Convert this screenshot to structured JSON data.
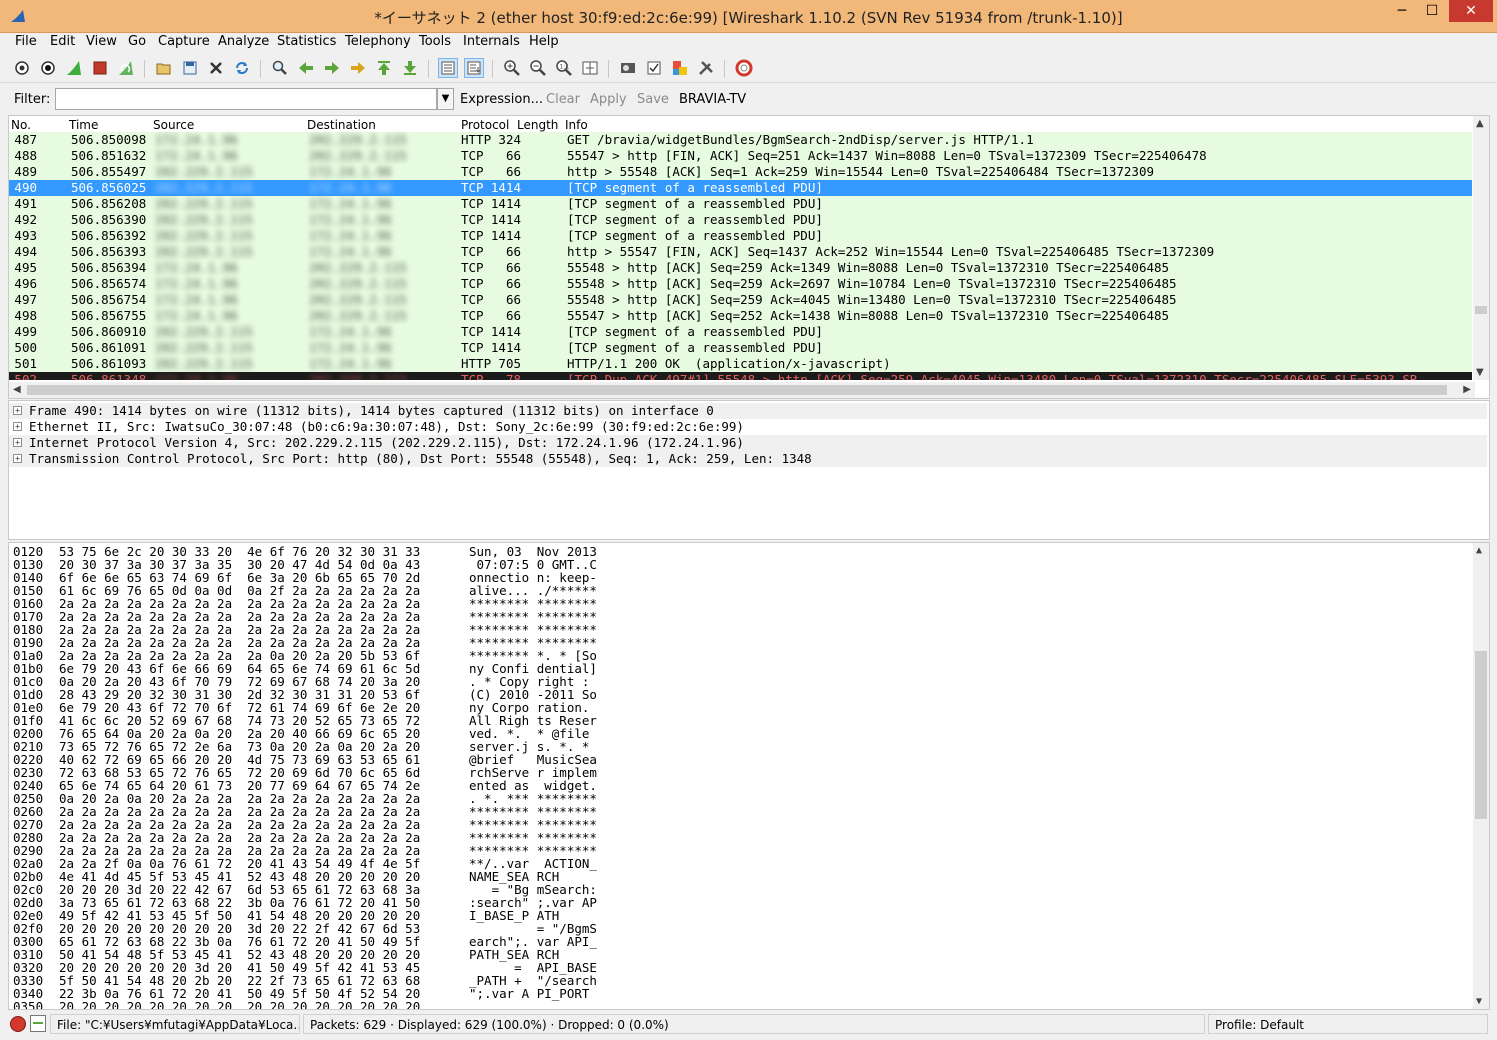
{
  "window": {
    "title": "*イーサネット 2 (ether host 30:f9:ed:2c:6e:99)   [Wireshark 1.10.2  (SVN Rev 51934 from /trunk-1.10)]",
    "minimize": "─",
    "maximize": "☐",
    "close": "✕"
  },
  "menu": [
    "File",
    "Edit",
    "View",
    "Go",
    "Capture",
    "Analyze",
    "Statistics",
    "Telephony",
    "Tools",
    "Internals",
    "Help"
  ],
  "filter": {
    "label": "Filter:",
    "value": "",
    "expression": "Expression...",
    "clear": "Clear",
    "apply": "Apply",
    "save": "Save",
    "saved_button": "BRAVIA-TV"
  },
  "packet_list": {
    "columns": [
      "No.",
      "Time",
      "Source",
      "Destination",
      "Protocol",
      "Length",
      "Info"
    ],
    "rows": [
      {
        "no": "487",
        "time": "506.850098",
        "src": "172.24.1.96",
        "dst": "202.229.2.115",
        "proto": "HTTP",
        "len": "324",
        "info": "GET /bravia/widgetBundles/BgmSearch-2ndDisp/server.js HTTP/1.1"
      },
      {
        "no": "488",
        "time": "506.851632",
        "src": "172.24.1.96",
        "dst": "202.229.2.115",
        "proto": "TCP",
        "len": "66",
        "info": "55547 > http [FIN, ACK] Seq=251 Ack=1437 Win=8088 Len=0 TSval=1372309 TSecr=225406478"
      },
      {
        "no": "489",
        "time": "506.855497",
        "src": "202.229.2.115",
        "dst": "172.24.1.96",
        "proto": "TCP",
        "len": "66",
        "info": "http > 55548 [ACK] Seq=1 Ack=259 Win=15544 Len=0 TSval=225406484 TSecr=1372309"
      },
      {
        "no": "490",
        "time": "506.856025",
        "src": "202.229.2.115",
        "dst": "172.24.1.96",
        "proto": "TCP",
        "len": "1414",
        "info": "[TCP segment of a reassembled PDU]",
        "selected": true
      },
      {
        "no": "491",
        "time": "506.856208",
        "src": "202.229.2.115",
        "dst": "172.24.1.96",
        "proto": "TCP",
        "len": "1414",
        "info": "[TCP segment of a reassembled PDU]"
      },
      {
        "no": "492",
        "time": "506.856390",
        "src": "202.229.2.115",
        "dst": "172.24.1.96",
        "proto": "TCP",
        "len": "1414",
        "info": "[TCP segment of a reassembled PDU]"
      },
      {
        "no": "493",
        "time": "506.856392",
        "src": "202.229.2.115",
        "dst": "172.24.1.96",
        "proto": "TCP",
        "len": "1414",
        "info": "[TCP segment of a reassembled PDU]"
      },
      {
        "no": "494",
        "time": "506.856393",
        "src": "202.229.2.115",
        "dst": "172.24.1.96",
        "proto": "TCP",
        "len": "66",
        "info": "http > 55547 [FIN, ACK] Seq=1437 Ack=252 Win=15544 Len=0 TSval=225406485 TSecr=1372309"
      },
      {
        "no": "495",
        "time": "506.856394",
        "src": "172.24.1.96",
        "dst": "202.229.2.115",
        "proto": "TCP",
        "len": "66",
        "info": "55548 > http [ACK] Seq=259 Ack=1349 Win=8088 Len=0 TSval=1372310 TSecr=225406485"
      },
      {
        "no": "496",
        "time": "506.856574",
        "src": "172.24.1.96",
        "dst": "202.229.2.115",
        "proto": "TCP",
        "len": "66",
        "info": "55548 > http [ACK] Seq=259 Ack=2697 Win=10784 Len=0 TSval=1372310 TSecr=225406485"
      },
      {
        "no": "497",
        "time": "506.856754",
        "src": "172.24.1.96",
        "dst": "202.229.2.115",
        "proto": "TCP",
        "len": "66",
        "info": "55548 > http [ACK] Seq=259 Ack=4045 Win=13480 Len=0 TSval=1372310 TSecr=225406485"
      },
      {
        "no": "498",
        "time": "506.856755",
        "src": "172.24.1.96",
        "dst": "202.229.2.115",
        "proto": "TCP",
        "len": "66",
        "info": "55547 > http [ACK] Seq=252 Ack=1438 Win=8088 Len=0 TSval=1372310 TSecr=225406485"
      },
      {
        "no": "499",
        "time": "506.860910",
        "src": "202.229.2.115",
        "dst": "172.24.1.96",
        "proto": "TCP",
        "len": "1414",
        "info": "[TCP segment of a reassembled PDU]"
      },
      {
        "no": "500",
        "time": "506.861091",
        "src": "202.229.2.115",
        "dst": "172.24.1.96",
        "proto": "TCP",
        "len": "1414",
        "info": "[TCP segment of a reassembled PDU]"
      },
      {
        "no": "501",
        "time": "506.861093",
        "src": "202.229.2.115",
        "dst": "172.24.1.96",
        "proto": "HTTP",
        "len": "705",
        "info": "HTTP/1.1 200 OK  (application/x-javascript)"
      },
      {
        "no": "502",
        "time": "506.861348",
        "src": "172.24.1.96",
        "dst": "202.229.2.115",
        "proto": "TCP",
        "len": "78",
        "info": "[TCP Dup ACK 497#1] 55548 > http [ACK] Seq=259 Ack=4045 Win=13480 Len=0 TSval=1372310 TSecr=225406485 SLE=5393 SR",
        "partial": true
      }
    ]
  },
  "details": [
    "Frame 490: 1414 bytes on wire (11312 bits), 1414 bytes captured (11312 bits) on interface 0",
    "Ethernet II, Src: IwatsuCo_30:07:48 (b0:c6:9a:30:07:48), Dst: Sony_2c:6e:99 (30:f9:ed:2c:6e:99)",
    "Internet Protocol Version 4, Src: 202.229.2.115 (202.229.2.115), Dst: 172.24.1.96 (172.24.1.96)",
    "Transmission Control Protocol, Src Port: http (80), Dst Port: 55548 (55548), Seq: 1, Ack: 259, Len: 1348"
  ],
  "hex": [
    {
      "off": "0120",
      "hex": "53 75 6e 2c 20 30 33 20  4e 6f 76 20 32 30 31 33",
      "ascii": "Sun, 03  Nov 2013"
    },
    {
      "off": "0130",
      "hex": "20 30 37 3a 30 37 3a 35  30 20 47 4d 54 0d 0a 43",
      "ascii": " 07:07:5 0 GMT..C"
    },
    {
      "off": "0140",
      "hex": "6f 6e 6e 65 63 74 69 6f  6e 3a 20 6b 65 65 70 2d",
      "ascii": "onnectio n: keep-"
    },
    {
      "off": "0150",
      "hex": "61 6c 69 76 65 0d 0a 0d  0a 2f 2a 2a 2a 2a 2a 2a",
      "ascii": "alive... ./******"
    },
    {
      "off": "0160",
      "hex": "2a 2a 2a 2a 2a 2a 2a 2a  2a 2a 2a 2a 2a 2a 2a 2a",
      "ascii": "******** ********"
    },
    {
      "off": "0170",
      "hex": "2a 2a 2a 2a 2a 2a 2a 2a  2a 2a 2a 2a 2a 2a 2a 2a",
      "ascii": "******** ********"
    },
    {
      "off": "0180",
      "hex": "2a 2a 2a 2a 2a 2a 2a 2a  2a 2a 2a 2a 2a 2a 2a 2a",
      "ascii": "******** ********"
    },
    {
      "off": "0190",
      "hex": "2a 2a 2a 2a 2a 2a 2a 2a  2a 2a 2a 2a 2a 2a 2a 2a",
      "ascii": "******** ********"
    },
    {
      "off": "01a0",
      "hex": "2a 2a 2a 2a 2a 2a 2a 2a  2a 0a 20 2a 20 5b 53 6f",
      "ascii": "******** *. * [So"
    },
    {
      "off": "01b0",
      "hex": "6e 79 20 43 6f 6e 66 69  64 65 6e 74 69 61 6c 5d",
      "ascii": "ny Confi dential]"
    },
    {
      "off": "01c0",
      "hex": "0a 20 2a 20 43 6f 70 79  72 69 67 68 74 20 3a 20",
      "ascii": ". * Copy right : "
    },
    {
      "off": "01d0",
      "hex": "28 43 29 20 32 30 31 30  2d 32 30 31 31 20 53 6f",
      "ascii": "(C) 2010 -2011 So"
    },
    {
      "off": "01e0",
      "hex": "6e 79 20 43 6f 72 70 6f  72 61 74 69 6f 6e 2e 20",
      "ascii": "ny Corpo ration. "
    },
    {
      "off": "01f0",
      "hex": "41 6c 6c 20 52 69 67 68  74 73 20 52 65 73 65 72",
      "ascii": "All Righ ts Reser"
    },
    {
      "off": "0200",
      "hex": "76 65 64 0a 20 2a 0a 20  2a 20 40 66 69 6c 65 20",
      "ascii": "ved. *.  * @file "
    },
    {
      "off": "0210",
      "hex": "73 65 72 76 65 72 2e 6a  73 0a 20 2a 0a 20 2a 20",
      "ascii": "server.j s. *. * "
    },
    {
      "off": "0220",
      "hex": "40 62 72 69 65 66 20 20  4d 75 73 69 63 53 65 61",
      "ascii": "@brief   MusicSea"
    },
    {
      "off": "0230",
      "hex": "72 63 68 53 65 72 76 65  72 20 69 6d 70 6c 65 6d",
      "ascii": "rchServe r implem"
    },
    {
      "off": "0240",
      "hex": "65 6e 74 65 64 20 61 73  20 77 69 64 67 65 74 2e",
      "ascii": "ented as  widget."
    },
    {
      "off": "0250",
      "hex": "0a 20 2a 0a 20 2a 2a 2a  2a 2a 2a 2a 2a 2a 2a 2a",
      "ascii": ". *. *** ********"
    },
    {
      "off": "0260",
      "hex": "2a 2a 2a 2a 2a 2a 2a 2a  2a 2a 2a 2a 2a 2a 2a 2a",
      "ascii": "******** ********"
    },
    {
      "off": "0270",
      "hex": "2a 2a 2a 2a 2a 2a 2a 2a  2a 2a 2a 2a 2a 2a 2a 2a",
      "ascii": "******** ********"
    },
    {
      "off": "0280",
      "hex": "2a 2a 2a 2a 2a 2a 2a 2a  2a 2a 2a 2a 2a 2a 2a 2a",
      "ascii": "******** ********"
    },
    {
      "off": "0290",
      "hex": "2a 2a 2a 2a 2a 2a 2a 2a  2a 2a 2a 2a 2a 2a 2a 2a",
      "ascii": "******** ********"
    },
    {
      "off": "02a0",
      "hex": "2a 2a 2f 0a 0a 76 61 72  20 41 43 54 49 4f 4e 5f",
      "ascii": "**/..var  ACTION_"
    },
    {
      "off": "02b0",
      "hex": "4e 41 4d 45 5f 53 45 41  52 43 48 20 20 20 20 20",
      "ascii": "NAME_SEA RCH     "
    },
    {
      "off": "02c0",
      "hex": "20 20 20 3d 20 22 42 67  6d 53 65 61 72 63 68 3a",
      "ascii": "   = \"Bg mSearch:"
    },
    {
      "off": "02d0",
      "hex": "3a 73 65 61 72 63 68 22  3b 0a 76 61 72 20 41 50",
      "ascii": ":search\" ;.var AP"
    },
    {
      "off": "02e0",
      "hex": "49 5f 42 41 53 45 5f 50  41 54 48 20 20 20 20 20",
      "ascii": "I_BASE_P ATH     "
    },
    {
      "off": "02f0",
      "hex": "20 20 20 20 20 20 20 20  3d 20 22 2f 42 67 6d 53",
      "ascii": "         = \"/BgmS"
    },
    {
      "off": "0300",
      "hex": "65 61 72 63 68 22 3b 0a  76 61 72 20 41 50 49 5f",
      "ascii": "earch\";. var API_"
    },
    {
      "off": "0310",
      "hex": "50 41 54 48 5f 53 45 41  52 43 48 20 20 20 20 20",
      "ascii": "PATH_SEA RCH     "
    },
    {
      "off": "0320",
      "hex": "20 20 20 20 20 20 3d 20  41 50 49 5f 42 41 53 45",
      "ascii": "      =  API_BASE"
    },
    {
      "off": "0330",
      "hex": "5f 50 41 54 48 20 2b 20  22 2f 73 65 61 72 63 68",
      "ascii": "_PATH +  \"/search"
    },
    {
      "off": "0340",
      "hex": "22 3b 0a 76 61 72 20 41  50 49 5f 50 4f 52 54 20",
      "ascii": "\";.var A PI_PORT "
    },
    {
      "off": "0350",
      "hex": "20 20 20 20 20 20 20 20  20 20 20 20 20 20 20 20",
      "ascii": "                 "
    }
  ],
  "status": {
    "file": "File: \"C:¥Users¥mfutagi¥AppData¥Loca…",
    "packets": "Packets: 629 · Displayed: 629 (100.0%) · Dropped: 0 (0.0%)",
    "profile": "Profile: Default"
  },
  "colors": {
    "title_bar": "#f2b87a",
    "row_tcp_http": "#e7fbe0",
    "row_selected": "#3399ff",
    "row_bad_tcp": "#1c1c1c",
    "close_button": "#c7392f"
  }
}
